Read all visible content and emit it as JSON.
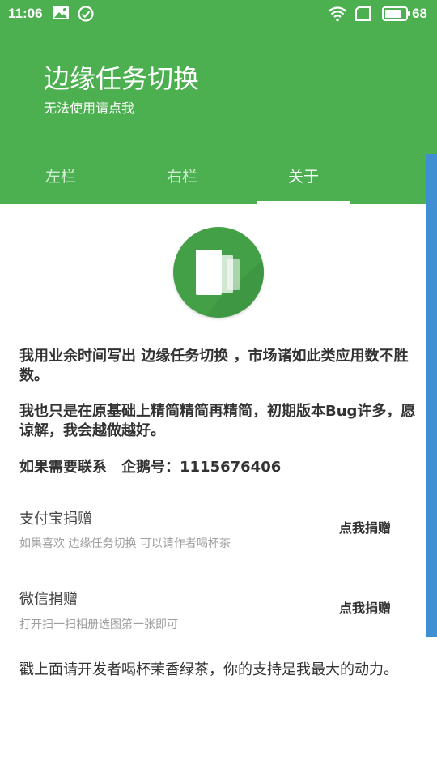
{
  "status_bar": {
    "time": "11:06",
    "battery": "68",
    "icons": [
      "image-icon",
      "check-circle-icon",
      "wifi-icon",
      "sim-icon",
      "battery-icon"
    ]
  },
  "header": {
    "title": "边缘任务切换",
    "subtitle": "无法使用请点我",
    "color": "#4caf50"
  },
  "tabs": [
    {
      "label": "左栏"
    },
    {
      "label": "右栏"
    },
    {
      "label": "关于"
    }
  ],
  "selected_tab": "关于",
  "content": {
    "para1": "我用业余时间写出 边缘任务切换 ，市场诸如此类应用数不胜数。",
    "para2": "我也只是在原基础上精简精简再精简，初期版本Bug许多，愿谅解，我会越做越好。",
    "para3": "如果需要联系　企鹅号：1115676406"
  },
  "donations": [
    {
      "title": "支付宝捐赠",
      "desc": "如果喜欢 边缘任务切换 可以请作者喝杯茶",
      "button": "点我捐赠"
    },
    {
      "title": "微信捐赠",
      "desc": "打开扫一扫相册选图第一张即可",
      "button": "点我捐赠"
    }
  ],
  "footer": "戳上面请开发者喝杯茉香绿茶，你的支持是我最大的动力。",
  "colors": {
    "edge_bar": "#3f8fd3",
    "logo": "#43a047"
  }
}
